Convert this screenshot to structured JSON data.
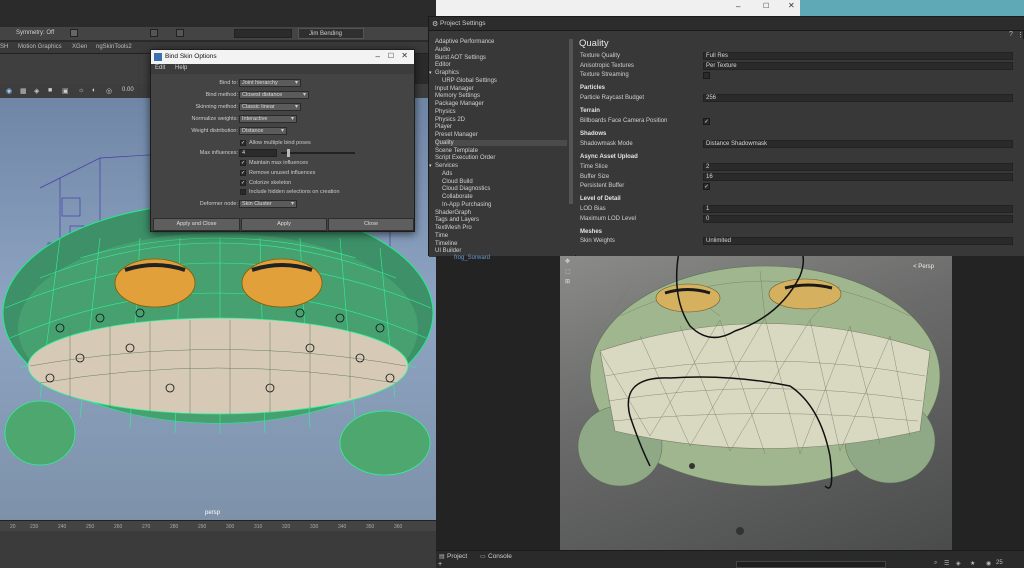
{
  "maya": {
    "symmetry": "Symmetry: Off",
    "user": "Jim Bending",
    "shelf_tabs": [
      "SH",
      "Motion Graphics",
      "XGen",
      "ngSkinTools2"
    ],
    "zoom_value": "0.00",
    "viewport_label": "persp",
    "timeline_ticks": [
      "20",
      "230",
      "240",
      "250",
      "260",
      "270",
      "280",
      "290",
      "300",
      "310",
      "320",
      "330",
      "340",
      "350",
      "360"
    ]
  },
  "bind_skin": {
    "title": "Bind Skin Options",
    "menu": [
      "Edit",
      "Help"
    ],
    "fields": [
      {
        "label": "Bind to:",
        "value": "Joint hierarchy"
      },
      {
        "label": "Bind method:",
        "value": "Closest distance"
      },
      {
        "label": "Skinning method:",
        "value": "Classic linear"
      },
      {
        "label": "Normalize weights:",
        "value": "Interactive"
      },
      {
        "label": "Weight distribution:",
        "value": "Distance"
      }
    ],
    "allow_multiple": "Allow multiple bind poses",
    "max_influences_label": "Max influences:",
    "max_influences_value": "4",
    "checks": [
      {
        "label": "Maintain max influences",
        "checked": true
      },
      {
        "label": "Remove unused influences",
        "checked": true
      },
      {
        "label": "Colorize skeleton",
        "checked": true
      },
      {
        "label": "Include hidden selections on creation",
        "checked": false
      }
    ],
    "deformer_label": "Deformer node:",
    "deformer_value": "Skin Cluster",
    "buttons": [
      "Apply and Close",
      "Apply",
      "Close"
    ]
  },
  "unity": {
    "window_title": "Project Settings",
    "sidebar": [
      {
        "label": "Adaptive Performance",
        "indent": 0
      },
      {
        "label": "Audio",
        "indent": 0
      },
      {
        "label": "Burst AOT Settings",
        "indent": 0
      },
      {
        "label": "Editor",
        "indent": 0
      },
      {
        "label": "Graphics",
        "indent": 0,
        "group": true
      },
      {
        "label": "URP Global Settings",
        "indent": 1
      },
      {
        "label": "Input Manager",
        "indent": 0
      },
      {
        "label": "Memory Settings",
        "indent": 0
      },
      {
        "label": "Package Manager",
        "indent": 0
      },
      {
        "label": "Physics",
        "indent": 0
      },
      {
        "label": "Physics 2D",
        "indent": 0
      },
      {
        "label": "Player",
        "indent": 0
      },
      {
        "label": "Preset Manager",
        "indent": 0
      },
      {
        "label": "Quality",
        "indent": 0,
        "selected": true
      },
      {
        "label": "Scene Template",
        "indent": 0
      },
      {
        "label": "Script Execution Order",
        "indent": 0
      },
      {
        "label": "Services",
        "indent": 0,
        "group": true
      },
      {
        "label": "Ads",
        "indent": 1
      },
      {
        "label": "Cloud Build",
        "indent": 1
      },
      {
        "label": "Cloud Diagnostics",
        "indent": 1
      },
      {
        "label": "Collaborate",
        "indent": 1
      },
      {
        "label": "In-App Purchasing",
        "indent": 1
      },
      {
        "label": "ShaderGraph",
        "indent": 0
      },
      {
        "label": "Tags and Layers",
        "indent": 0
      },
      {
        "label": "TextMesh Pro",
        "indent": 0
      },
      {
        "label": "Time",
        "indent": 0
      },
      {
        "label": "Timeline",
        "indent": 0
      },
      {
        "label": "UI Builder",
        "indent": 0
      }
    ],
    "main_title": "Quality",
    "rows": [
      {
        "type": "field",
        "label": "Texture Quality",
        "value": "Full Res"
      },
      {
        "type": "field",
        "label": "Anisotropic Textures",
        "value": "Per Texture"
      },
      {
        "type": "check",
        "label": "Texture Streaming",
        "checked": false
      },
      {
        "type": "section",
        "label": "Particles"
      },
      {
        "type": "field",
        "label": "Particle Raycast Budget",
        "value": "256"
      },
      {
        "type": "section",
        "label": "Terrain"
      },
      {
        "type": "check",
        "label": "Billboards Face Camera Position",
        "checked": true
      },
      {
        "type": "section",
        "label": "Shadows"
      },
      {
        "type": "field",
        "label": "Shadowmask Mode",
        "value": "Distance Shadowmask"
      },
      {
        "type": "section",
        "label": "Async Asset Upload"
      },
      {
        "type": "field",
        "label": "Time Slice",
        "value": "2"
      },
      {
        "type": "field",
        "label": "Buffer Size",
        "value": "16"
      },
      {
        "type": "check",
        "label": "Persistent Buffer",
        "checked": true
      },
      {
        "type": "section",
        "label": "Level of Detail"
      },
      {
        "type": "field",
        "label": "LOD Bias",
        "value": "1"
      },
      {
        "type": "field",
        "label": "Maximum LOD Level",
        "value": "0"
      },
      {
        "type": "section",
        "label": "Meshes"
      },
      {
        "type": "field",
        "label": "Skin Weights",
        "value": "Unlimited"
      }
    ],
    "hierarchy_item": "frog_Sorward",
    "scene_label": "< Persp",
    "bottom_tabs": [
      "Project",
      "Console"
    ],
    "bottom_count": "25"
  }
}
